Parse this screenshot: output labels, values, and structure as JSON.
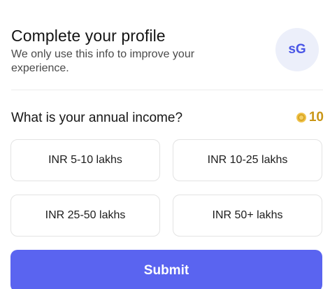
{
  "header": {
    "title": "Complete your profile",
    "subtitle": "We only use this info to improve your experience.",
    "avatar_initials": "sG"
  },
  "question": {
    "text": "What is your annual income?",
    "reward": {
      "icon": "coin-icon",
      "amount": "10"
    }
  },
  "options": [
    {
      "label": "INR 5-10 lakhs"
    },
    {
      "label": "INR 10-25 lakhs"
    },
    {
      "label": "INR 25-50 lakhs"
    },
    {
      "label": "INR 50+ lakhs"
    }
  ],
  "actions": {
    "submit_label": "Submit"
  },
  "colors": {
    "accent": "#5a64f0",
    "avatar_bg": "#eceffa",
    "coin": "#c99616"
  }
}
